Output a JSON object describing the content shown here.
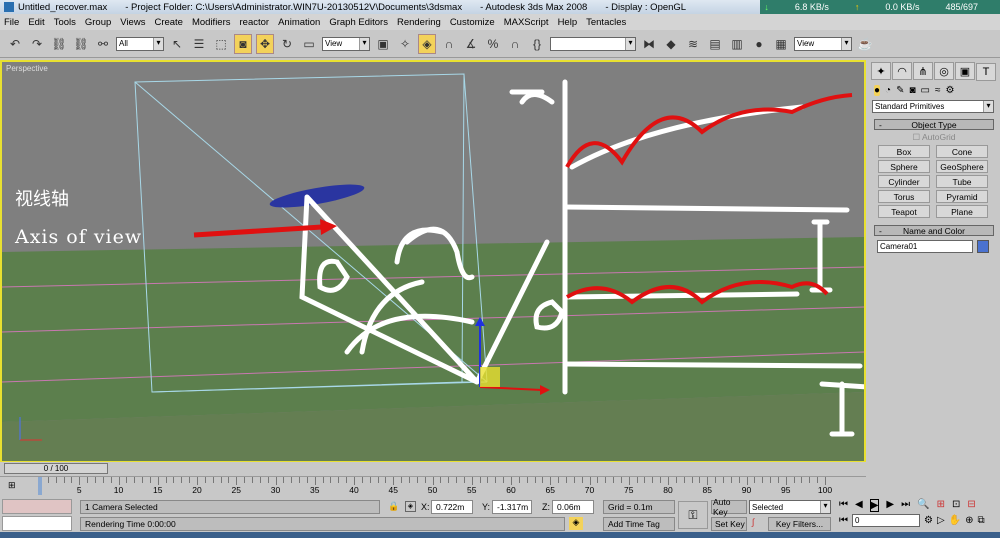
{
  "titlebar": {
    "file": "Untitled_recover.max",
    "project": "- Project Folder: C:\\Users\\Administrator.WIN7U-20130512V\\Documents\\3dsmax",
    "app": "- Autodesk 3ds Max 2008",
    "display": "- Display : OpenGL",
    "net_down": "6.8 KB/s",
    "net_up": "0.0 KB/s",
    "net_count": "485/697"
  },
  "menu": [
    "File",
    "Edit",
    "Tools",
    "Group",
    "Views",
    "Create",
    "Modifiers",
    "reactor",
    "Animation",
    "Graph Editors",
    "Rendering",
    "Customize",
    "MAXScript",
    "Help",
    "Tentacles"
  ],
  "toolbar": {
    "selection_filter": "All",
    "ref_coord": "View",
    "named_sel": "",
    "render_view": "View"
  },
  "viewport": {
    "label": "Perspective",
    "annotation_cn": "视线轴",
    "annotation_en": "Axis of view",
    "accent": "#e8e030"
  },
  "panel": {
    "category": "Standard Primitives",
    "object_type": "Object Type",
    "autogrid": "AutoGrid",
    "buttons": [
      "Box",
      "Cone",
      "Sphere",
      "GeoSphere",
      "Cylinder",
      "Tube",
      "Torus",
      "Pyramid",
      "Teapot",
      "Plane"
    ],
    "name_color": "Name and Color",
    "object_name": "Camera01",
    "object_color": "#4a72d0"
  },
  "timeline": {
    "frame": "0 / 100",
    "ticks": [
      "0",
      "5",
      "10",
      "15",
      "20",
      "25",
      "30",
      "35",
      "40",
      "45",
      "50",
      "55",
      "60",
      "65",
      "70",
      "75",
      "80",
      "85",
      "90",
      "95",
      "100"
    ]
  },
  "status": {
    "selected": "1 Camera Selected",
    "rendering_time": "Rendering Time  0:00:00",
    "x": "0.722m",
    "y": "-1.317m",
    "z": "0.06m",
    "grid": "Grid = 0.1m",
    "add_time_tag": "Add Time Tag",
    "auto_key": "Auto Key",
    "set_key": "Set Key",
    "key_mode": "Selected",
    "key_filters": "Key Filters...",
    "current_frame": "0",
    "x_label": "X:",
    "y_label": "Y:",
    "z_label": "Z:"
  }
}
